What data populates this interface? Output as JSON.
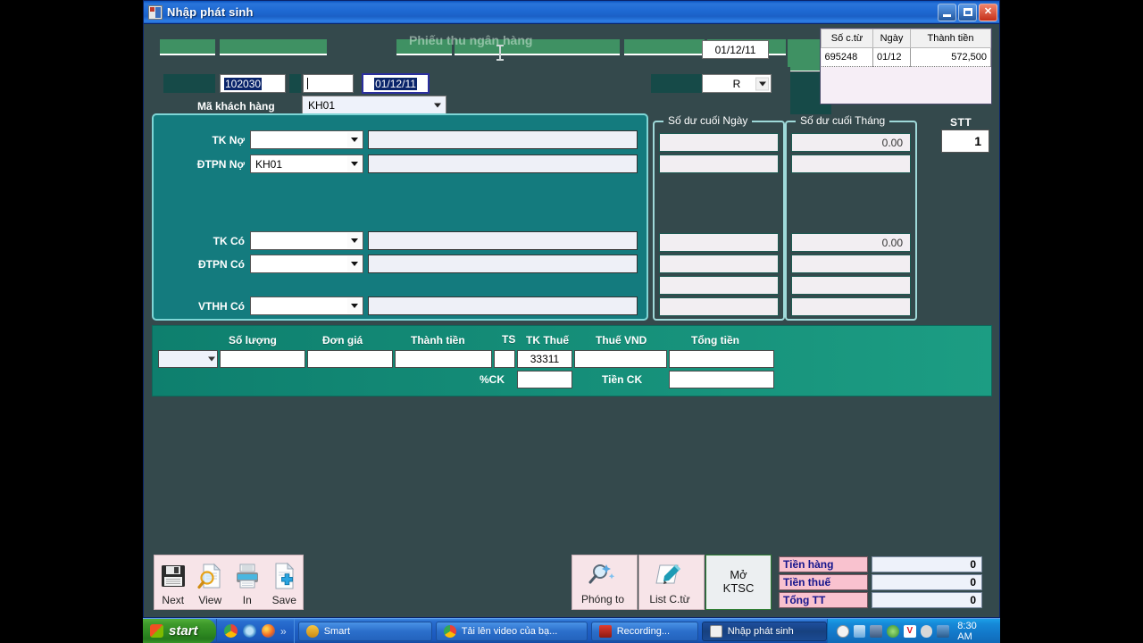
{
  "window": {
    "title": "Nhập phát sinh",
    "icon": "app-window-icon",
    "minimize_label": "",
    "maximize_label": "",
    "close_label": "✕"
  },
  "header": {
    "ghost_title": "Phiếu thu ngân hàng",
    "doc_number": "102030",
    "doc_number_suffix": "",
    "empty_field_value": "",
    "date_value": "01/12/11",
    "date_top_value": "01/12/11",
    "type_select_value": "R",
    "customer_label": "Mã khách hàng",
    "customer_value": "KH01"
  },
  "voucher_list": {
    "columns": [
      "Số c.từ",
      "Ngày",
      "Thành tiền"
    ],
    "rows": [
      {
        "so_ctu": "695248",
        "ngay": "01/12",
        "thanh_tien": "572,500"
      }
    ]
  },
  "accounts": {
    "rows": [
      {
        "label": "TK Nợ",
        "code": "",
        "name": ""
      },
      {
        "label": "ĐTPN Nợ",
        "code": "KH01",
        "name": ""
      },
      {
        "label": "TK Có",
        "code": "",
        "name": ""
      },
      {
        "label": "ĐTPN Có",
        "code": "",
        "name": ""
      },
      {
        "label": "VTHH Có",
        "code": "",
        "name": ""
      }
    ]
  },
  "balances": {
    "day": {
      "title": "Số dư cuối Ngày",
      "values": [
        "",
        "",
        "",
        "",
        "",
        ""
      ]
    },
    "month": {
      "title": "Số dư cuối Tháng",
      "values": [
        "0.00",
        "",
        "0.00",
        "",
        "",
        ""
      ]
    }
  },
  "stt": {
    "label": "STT",
    "value": "1"
  },
  "detail": {
    "columns": [
      "Số lượng",
      "Đơn giá",
      "Thành tiền",
      "TS",
      "TK Thuế",
      "Thuế VND",
      "Tổng tiền"
    ],
    "row": {
      "unit": "",
      "so_luong": "",
      "don_gia": "",
      "thanh_tien": "",
      "ts": "",
      "tk_thue": "33311",
      "thue_vnd": "",
      "tong_tien": ""
    },
    "discount": {
      "pct_label": "%CK",
      "pct_value": "",
      "amount_label": "Tiền CK",
      "amount_value": ""
    }
  },
  "toolbar": {
    "left_buttons": [
      {
        "label": "Next",
        "icon": "floppy-save-icon"
      },
      {
        "label": "View",
        "icon": "magnifier-page-icon"
      },
      {
        "label": "In",
        "icon": "printer-icon"
      },
      {
        "label": "Save",
        "icon": "page-plus-icon"
      }
    ],
    "right_buttons": [
      {
        "label": "Phóng to",
        "icon": "zoom-wand-icon"
      },
      {
        "label": "List C.từ",
        "icon": "pen-page-icon"
      }
    ],
    "open_ktsc": {
      "line1": "Mở",
      "line2": "KTSC"
    }
  },
  "totals": [
    {
      "label": "Tiền hàng",
      "value": "0"
    },
    {
      "label": "Tiền thuế",
      "value": "0"
    },
    {
      "label": "Tổng TT",
      "value": "0"
    }
  ],
  "taskbar": {
    "start_label": "start",
    "quicklaunch_more": "»",
    "items": [
      {
        "label": "Smart",
        "active": false
      },
      {
        "label": "Tải lên video của bạ...",
        "active": false
      },
      {
        "label": "Recording...",
        "active": false
      },
      {
        "label": "Nhập phát sinh",
        "active": true
      }
    ],
    "clock": "8:30 AM"
  },
  "colors": {
    "window_bg": "#34494c",
    "panel_teal": "#147b7e",
    "detail_green": "#14907c",
    "titlebar_blue": "#1e69d2",
    "totals_pink": "#f9c2cf",
    "header_green": "#3f9163"
  }
}
